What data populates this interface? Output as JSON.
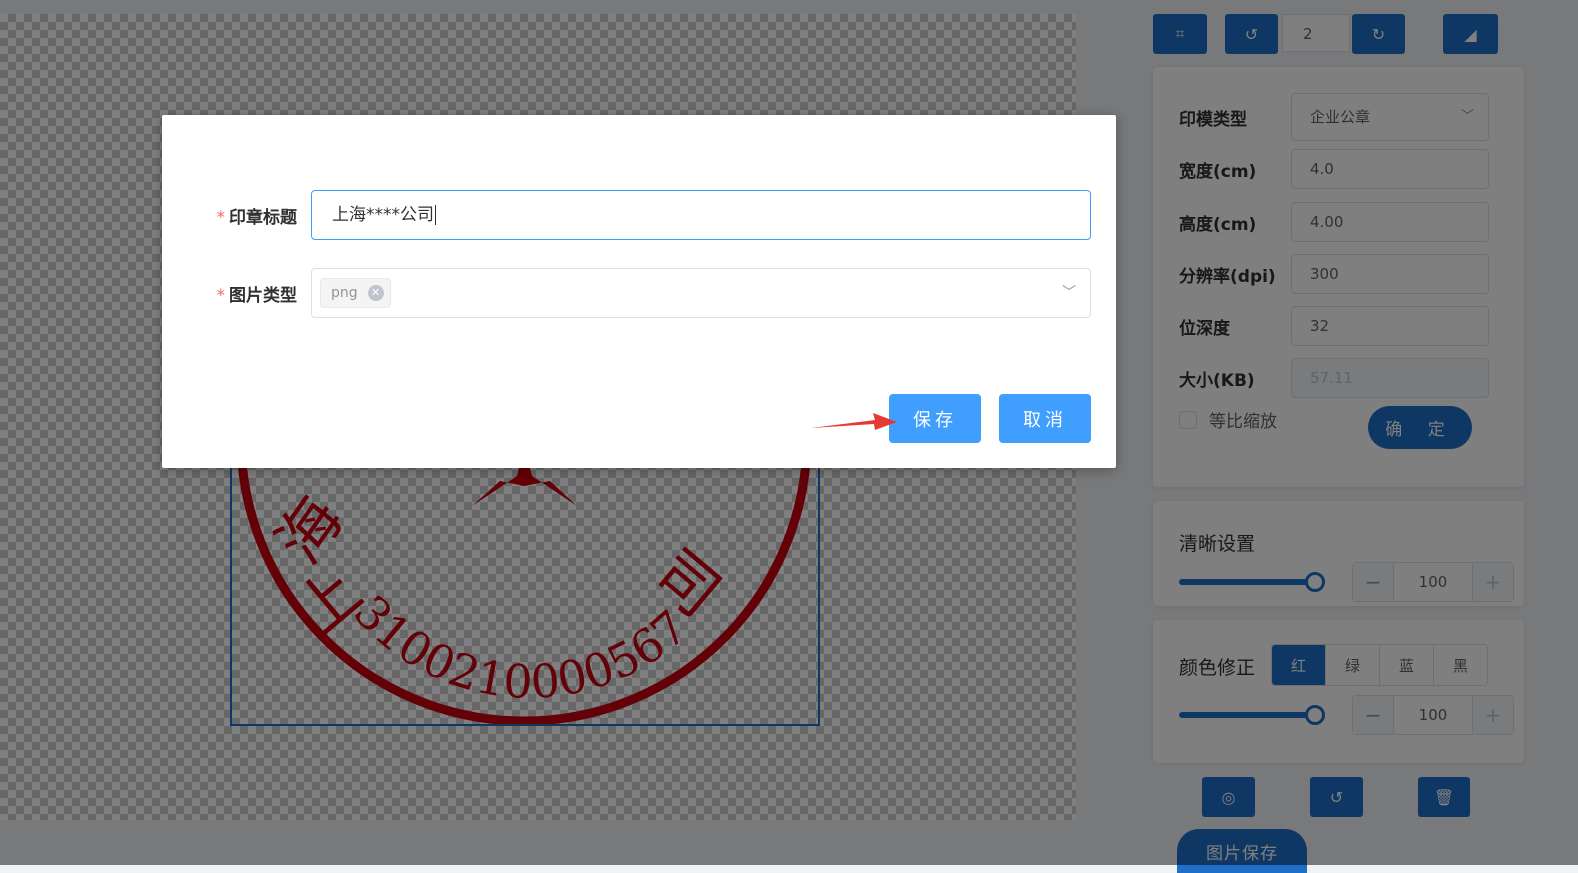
{
  "toolbar": {
    "rotation_value": "2"
  },
  "stamp": {
    "number_text": "3100210000567",
    "top_chars": [
      "上",
      "海",
      "司"
    ],
    "color": "#c8000f"
  },
  "properties": {
    "rows": [
      {
        "label": "印模类型",
        "value": "企业公章",
        "kind": "select"
      },
      {
        "label": "宽度(cm)",
        "value": "4.0",
        "kind": "input"
      },
      {
        "label": "高度(cm)",
        "value": "4.00",
        "kind": "input"
      },
      {
        "label": "分辨率(dpi)",
        "value": "300",
        "kind": "input"
      },
      {
        "label": "位深度",
        "value": "32",
        "kind": "input"
      },
      {
        "label": "大小(KB)",
        "value": "57.11",
        "kind": "disabled"
      }
    ],
    "proportional_label": "等比缩放",
    "confirm_label": "确 定"
  },
  "clarity": {
    "title": "清晰设置",
    "value": "100",
    "minus": "−",
    "plus": "+"
  },
  "color_fix": {
    "title": "颜色修正",
    "options": [
      "红",
      "绿",
      "蓝",
      "黑"
    ],
    "active": "红",
    "value": "100",
    "minus": "−",
    "plus": "+"
  },
  "bottom": {
    "save_image_label": "图片保存"
  },
  "dialog": {
    "title_label": "印章标题",
    "title_value": "上海****公司",
    "type_label": "图片类型",
    "type_tag": "png",
    "save_label": "保存",
    "cancel_label": "取消",
    "required_mark": "*"
  },
  "colors": {
    "primary": "#1f6fc9",
    "dialog_primary": "#409eff",
    "required": "#f56c6c",
    "arrow": "#e53935"
  }
}
